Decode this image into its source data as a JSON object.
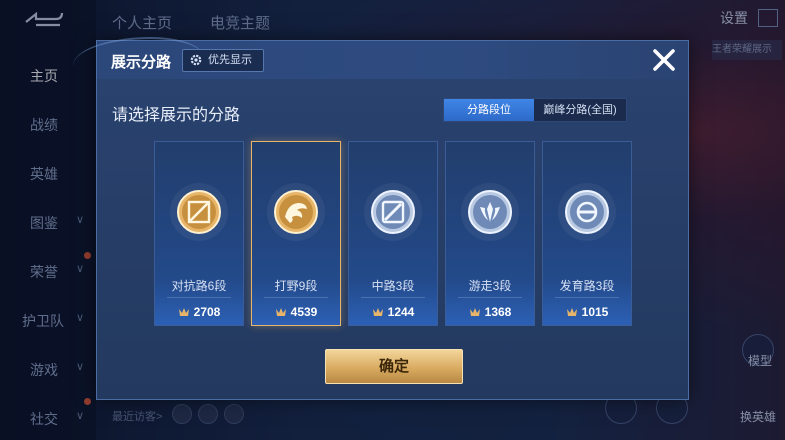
{
  "background": {
    "nav_items": [
      {
        "label": "主页",
        "active": true,
        "chevron": false
      },
      {
        "label": "战绩",
        "active": false,
        "chevron": false
      },
      {
        "label": "英雄",
        "active": false,
        "chevron": false
      },
      {
        "label": "图鉴",
        "active": false,
        "chevron": true
      },
      {
        "label": "荣誉",
        "active": false,
        "chevron": true
      },
      {
        "label": "护卫队",
        "active": false,
        "chevron": true
      },
      {
        "label": "游戏",
        "active": false,
        "chevron": true
      },
      {
        "label": "社交",
        "active": false,
        "chevron": true
      }
    ],
    "top_tabs": [
      "个人主页",
      "电竞主题"
    ],
    "settings_label": "设置",
    "top_right_strip": "王者荣耀展示",
    "visitor_label": "最近访客>",
    "model_label": "模型",
    "switch_label": "换英雄"
  },
  "modal": {
    "title": "展示分路",
    "priority_label": "优先显示",
    "section_title": "请选择展示的分路",
    "segments": [
      "分路段位",
      "巅峰分路(全国)"
    ],
    "active_segment": 0,
    "confirm_label": "确定",
    "cards": [
      {
        "rank": "对抗路6段",
        "score": "2708",
        "medal": "gold",
        "emblem": "sword-cross-icon",
        "selected": false
      },
      {
        "rank": "打野9段",
        "score": "4539",
        "medal": "gold",
        "emblem": "dragon-icon",
        "selected": true
      },
      {
        "rank": "中路3段",
        "score": "1244",
        "medal": "silver",
        "emblem": "staff-icon",
        "selected": false
      },
      {
        "rank": "游走3段",
        "score": "1368",
        "medal": "silver",
        "emblem": "wings-icon",
        "selected": false
      },
      {
        "rank": "发育路3段",
        "score": "1015",
        "medal": "silver",
        "emblem": "target-icon",
        "selected": false
      }
    ]
  },
  "colors": {
    "gold": "#e7b56a",
    "silver": "#b9c9e2",
    "accent_blue": "#3f86e6",
    "confirm_gold": "#d9ab61"
  }
}
